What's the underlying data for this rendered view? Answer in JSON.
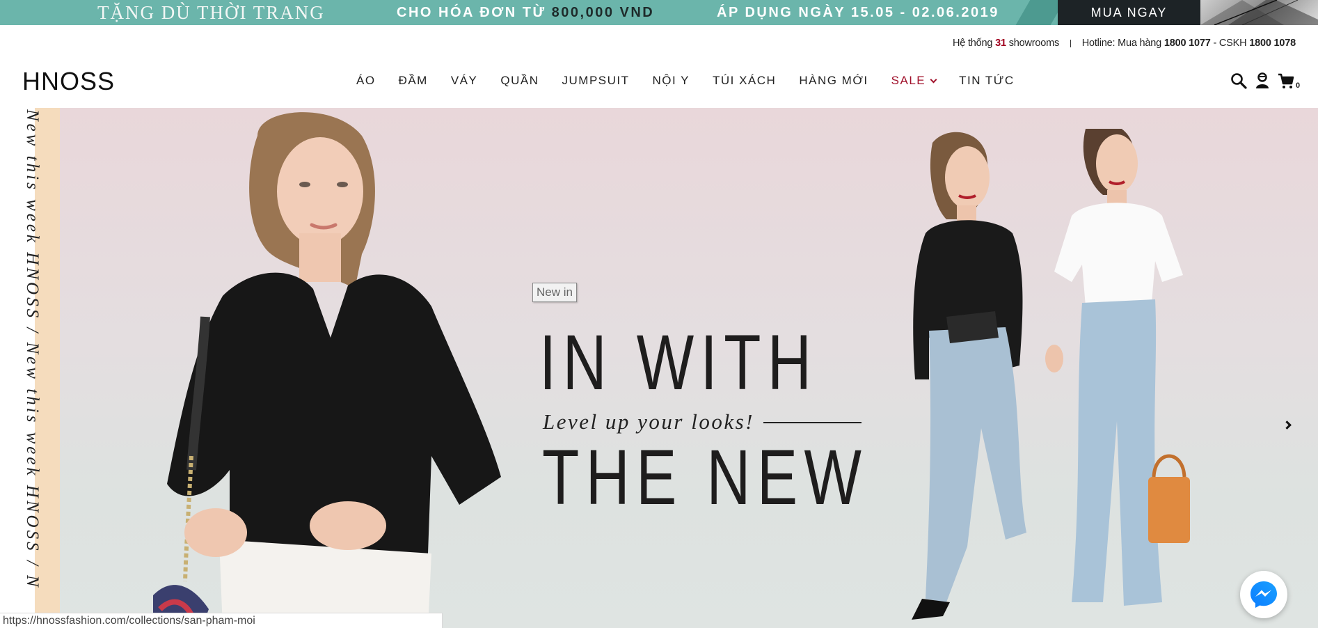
{
  "promo": {
    "gift_text": "TẶNG DÙ THỜI TRANG",
    "order_prefix": "CHO HÓA ĐƠN TỪ",
    "order_amount": "800,000 VND",
    "date_text": "ÁP DỤNG NGÀY 15.05 - 02.06.2019",
    "buy_now": "MUA NGAY"
  },
  "topbar": {
    "showroom_prefix": "Hệ thống",
    "showroom_count": "31",
    "showroom_suffix": "showrooms",
    "hotline_label": "Hotline: Mua hàng",
    "hotline_buy": "1800 1077",
    "cskh_label": "- CSKH",
    "hotline_cskh": "1800 1078"
  },
  "header": {
    "logo": "HNOSS",
    "nav": [
      "ÁO",
      "ĐẦM",
      "VÁY",
      "QUẦN",
      "JUMPSUIT",
      "NỘI Y",
      "TÚI XÁCH",
      "HÀNG MỚI",
      "SALE",
      "TIN TỨC"
    ],
    "cart_count": "0",
    "icons": [
      "search-icon",
      "account-icon",
      "cart-icon"
    ]
  },
  "hero": {
    "vertical_text": "New this week HNOSS / New this week HNOSS / N",
    "badge": "New in",
    "headline_top": "IN WITH",
    "tagline": "Level up your looks!",
    "headline_bottom": "THE NEW"
  },
  "status_url": "https://hnossfashion.com/collections/san-pham-moi",
  "colors": {
    "promo_bg": "#6bb5ab",
    "buy_bg": "#1d2326",
    "sale": "#a0102a",
    "vertical_strip": "#f5dcbd"
  }
}
